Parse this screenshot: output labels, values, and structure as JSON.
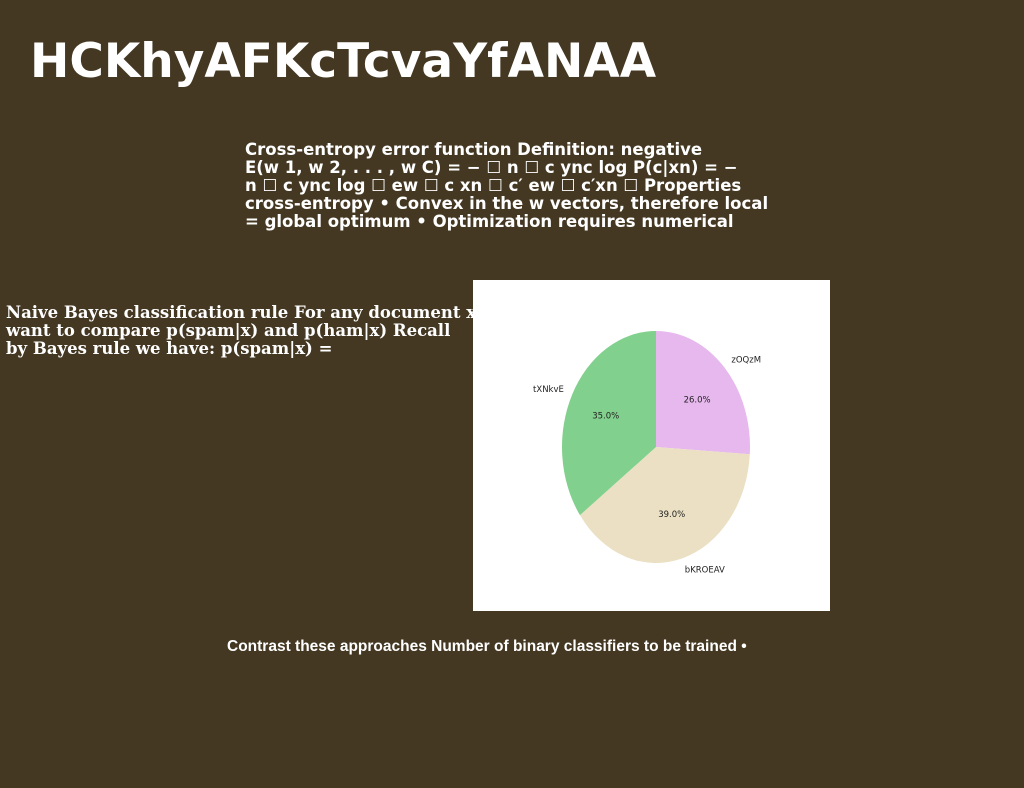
{
  "slide": {
    "title": "HCKhyAFKcTcvaYfANAA",
    "top_block": {
      "lines": [
        "Cross-entropy error function Definition: negative",
        "E(w 1, w 2, . . . , w C) = − ☐ n ☐ c ync log P(c|xn) = −",
        "n ☐ c ync log ☐ ew ☐ c xn ☐ c′ ew ☐ c′xn ☐ Properties",
        "cross-entropy • Convex in the w vectors, therefore local",
        "= global optimum • Optimization requires numerical"
      ]
    },
    "left_block": {
      "lines": [
        "Naive Bayes classification rule For any document x,",
        "want to compare p(spam|x) and p(ham|x) Recall",
        "by Bayes rule we have: p(spam|x) ="
      ]
    },
    "bottom_text": "Contrast these approaches Number of binary classifiers to be trained •"
  },
  "chart_data": {
    "type": "pie",
    "labels": [
      "zOQzM",
      "bKROEAV",
      "tXNkvE"
    ],
    "values": [
      26.0,
      39.0,
      35.0
    ],
    "value_labels": [
      "26.0%",
      "39.0%",
      "35.0%"
    ],
    "colors": [
      "#e6b8ee",
      "#ebe0c3",
      "#82d08d"
    ],
    "start_angle_deg": 90,
    "direction": "clockwise"
  }
}
